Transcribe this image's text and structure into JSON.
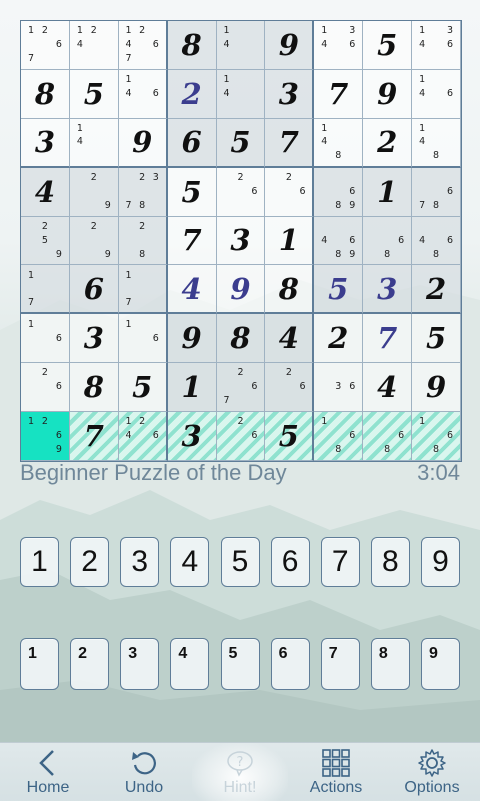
{
  "board": {
    "cells": [
      [
        {
          "n": [
            "1",
            "2",
            "6",
            "7"
          ],
          "p": [
            0,
            1,
            5,
            6
          ]
        },
        {
          "n": [
            "1",
            "2",
            "4"
          ],
          "p": [
            0,
            1,
            3
          ]
        },
        {
          "n": [
            "1",
            "2",
            "4",
            "6",
            "7"
          ],
          "p": [
            0,
            1,
            3,
            5,
            6
          ]
        },
        {
          "v": "8"
        },
        {
          "n": [
            "1",
            "4"
          ],
          "p": [
            0,
            3
          ]
        },
        {
          "v": "9"
        },
        {
          "n": [
            "1",
            "3",
            "4",
            "6"
          ],
          "p": [
            0,
            2,
            3,
            5
          ]
        },
        {
          "v": "5"
        },
        {
          "n": [
            "1",
            "3",
            "4",
            "6"
          ],
          "p": [
            0,
            2,
            3,
            5
          ]
        }
      ],
      [
        {
          "v": "8"
        },
        {
          "v": "5"
        },
        {
          "n": [
            "1",
            "4",
            "6"
          ],
          "p": [
            0,
            3,
            5
          ]
        },
        {
          "v": "2",
          "u": true
        },
        {
          "n": [
            "1",
            "4"
          ],
          "p": [
            0,
            3
          ]
        },
        {
          "v": "3"
        },
        {
          "v": "7"
        },
        {
          "v": "9"
        },
        {
          "n": [
            "1",
            "4",
            "6"
          ],
          "p": [
            0,
            3,
            5
          ]
        }
      ],
      [
        {
          "v": "3"
        },
        {
          "n": [
            "1",
            "4"
          ],
          "p": [
            0,
            3
          ]
        },
        {
          "v": "9"
        },
        {
          "v": "6"
        },
        {
          "v": "5"
        },
        {
          "v": "7"
        },
        {
          "n": [
            "1",
            "4",
            "8"
          ],
          "p": [
            0,
            3,
            7
          ]
        },
        {
          "v": "2"
        },
        {
          "n": [
            "1",
            "4",
            "8"
          ],
          "p": [
            0,
            3,
            7
          ]
        }
      ],
      [
        {
          "v": "4"
        },
        {
          "n": [
            "2",
            "9"
          ],
          "p": [
            1,
            8
          ]
        },
        {
          "n": [
            "2",
            "3",
            "7",
            "8"
          ],
          "p": [
            1,
            2,
            6,
            7
          ]
        },
        {
          "v": "5"
        },
        {
          "n": [
            "2",
            "6"
          ],
          "p": [
            1,
            5
          ]
        },
        {
          "n": [
            "2",
            "6"
          ],
          "p": [
            1,
            5
          ]
        },
        {
          "n": [
            "6",
            "8",
            "9"
          ],
          "p": [
            5,
            7,
            8
          ]
        },
        {
          "v": "1"
        },
        {
          "n": [
            "6",
            "7",
            "8"
          ],
          "p": [
            5,
            6,
            7
          ]
        }
      ],
      [
        {
          "n": [
            "2",
            "5",
            "9"
          ],
          "p": [
            1,
            4,
            8
          ]
        },
        {
          "n": [
            "2",
            "9"
          ],
          "p": [
            1,
            8
          ]
        },
        {
          "n": [
            "2",
            "8"
          ],
          "p": [
            1,
            7
          ]
        },
        {
          "v": "7"
        },
        {
          "v": "3"
        },
        {
          "v": "1"
        },
        {
          "n": [
            "4",
            "6",
            "8",
            "9"
          ],
          "p": [
            3,
            5,
            7,
            8
          ]
        },
        {
          "n": [
            "6",
            "8"
          ],
          "p": [
            5,
            7
          ]
        },
        {
          "n": [
            "4",
            "6",
            "8"
          ],
          "p": [
            3,
            5,
            7
          ]
        }
      ],
      [
        {
          "n": [
            "1",
            "7"
          ],
          "p": [
            0,
            6
          ]
        },
        {
          "v": "6"
        },
        {
          "n": [
            "1",
            "7"
          ],
          "p": [
            0,
            6
          ]
        },
        {
          "v": "4",
          "u": true
        },
        {
          "v": "9",
          "u": true
        },
        {
          "v": "8"
        },
        {
          "v": "5",
          "u": true
        },
        {
          "v": "3",
          "u": true
        },
        {
          "v": "2"
        }
      ],
      [
        {
          "n": [
            "1",
            "6"
          ],
          "p": [
            0,
            5
          ]
        },
        {
          "v": "3"
        },
        {
          "n": [
            "1",
            "6"
          ],
          "p": [
            0,
            5
          ]
        },
        {
          "v": "9"
        },
        {
          "v": "8"
        },
        {
          "v": "4"
        },
        {
          "v": "2"
        },
        {
          "v": "7",
          "u": true
        },
        {
          "v": "5"
        }
      ],
      [
        {
          "n": [
            "2",
            "6"
          ],
          "p": [
            1,
            5
          ]
        },
        {
          "v": "8"
        },
        {
          "v": "5"
        },
        {
          "v": "1"
        },
        {
          "n": [
            "2",
            "6",
            "7"
          ],
          "p": [
            1,
            5,
            6
          ]
        },
        {
          "n": [
            "2",
            "6"
          ],
          "p": [
            1,
            5
          ]
        },
        {
          "n": [
            "3",
            "6"
          ],
          "p": [
            4,
            5
          ]
        },
        {
          "v": "4"
        },
        {
          "v": "9"
        }
      ],
      [
        {
          "n": [
            "1",
            "2",
            "6",
            "9"
          ],
          "p": [
            0,
            1,
            5,
            8
          ]
        },
        {
          "v": "7"
        },
        {
          "n": [
            "1",
            "2",
            "4",
            "6"
          ],
          "p": [
            0,
            1,
            3,
            5
          ]
        },
        {
          "v": "3"
        },
        {
          "n": [
            "2",
            "6"
          ],
          "p": [
            1,
            5
          ]
        },
        {
          "v": "5"
        },
        {
          "n": [
            "1",
            "6",
            "8"
          ],
          "p": [
            0,
            5,
            7
          ]
        },
        {
          "n": [
            "6",
            "8"
          ],
          "p": [
            5,
            7
          ]
        },
        {
          "n": [
            "1",
            "6",
            "8"
          ],
          "p": [
            0,
            5,
            7
          ]
        }
      ]
    ],
    "selected_row": 8,
    "selected_col": 0
  },
  "status": {
    "title": "Beginner Puzzle of the Day",
    "timer": "3:04"
  },
  "number_buttons": [
    "1",
    "2",
    "3",
    "4",
    "5",
    "6",
    "7",
    "8",
    "9"
  ],
  "note_buttons": [
    "1",
    "2",
    "3",
    "4",
    "5",
    "6",
    "7",
    "8",
    "9"
  ],
  "toolbar": {
    "home": "Home",
    "undo": "Undo",
    "hint": "Hint!",
    "actions": "Actions",
    "options": "Options"
  },
  "colors": {
    "selected_cell": "#16e2c2",
    "highlight_stripe": "#8fe2cf",
    "user_digit": "#3b3d8e",
    "toolbar_icon": "#3d6486"
  }
}
